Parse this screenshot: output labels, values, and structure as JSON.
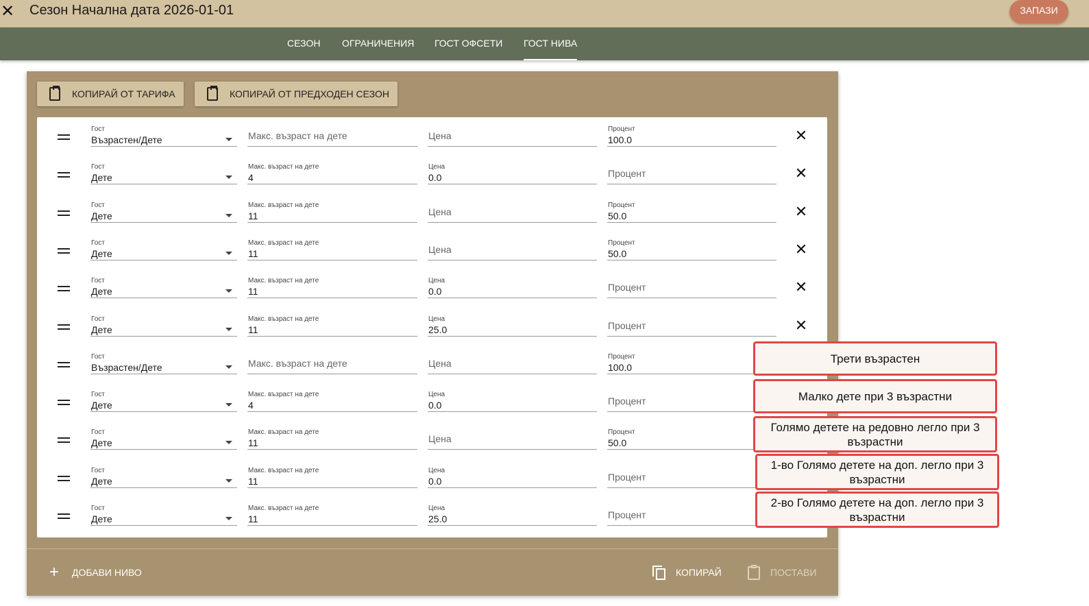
{
  "header": {
    "title": "Сезон Начална дата 2026-01-01",
    "close_icon": "close-icon",
    "save_label": "ЗАПАЗИ"
  },
  "tabs": [
    {
      "label": "СЕЗОН"
    },
    {
      "label": "ОГРАНИЧЕНИЯ"
    },
    {
      "label": "ГОСТ ОФСЕТИ"
    },
    {
      "label": "ГОСТ НИВА"
    }
  ],
  "active_tab": "ГОСТ НИВА",
  "actions": {
    "copy_from_tariff": "КОПИРАЙ ОТ ТАРИФА",
    "copy_from_previous": "КОПИРАЙ ОТ ПРЕДХОДЕН СЕЗОН"
  },
  "labels": {
    "guest": "Гост",
    "max_child_age": "Макс. възраст на дете",
    "price": "Цена",
    "percent": "Процент"
  },
  "rows": [
    {
      "guest": "Възрастен/Дете",
      "age": "",
      "price": "",
      "percent": "100.0",
      "deletable": true
    },
    {
      "guest": "Дете",
      "age": "4",
      "price": "0.0",
      "percent": "",
      "deletable": true
    },
    {
      "guest": "Дете",
      "age": "11",
      "price": "",
      "percent": "50.0",
      "deletable": true
    },
    {
      "guest": "Дете",
      "age": "11",
      "price": "",
      "percent": "50.0",
      "deletable": true
    },
    {
      "guest": "Дете",
      "age": "11",
      "price": "0.0",
      "percent": "",
      "deletable": true
    },
    {
      "guest": "Дете",
      "age": "11",
      "price": "25.0",
      "percent": "",
      "deletable": true
    },
    {
      "guest": "Възрастен/Дете",
      "age": "",
      "price": "",
      "percent": "100.0",
      "deletable": false
    },
    {
      "guest": "Дете",
      "age": "4",
      "price": "0.0",
      "percent": "",
      "deletable": false
    },
    {
      "guest": "Дете",
      "age": "11",
      "price": "",
      "percent": "50.0",
      "deletable": false
    },
    {
      "guest": "Дете",
      "age": "11",
      "price": "0.0",
      "percent": "",
      "deletable": false
    },
    {
      "guest": "Дете",
      "age": "11",
      "price": "25.0",
      "percent": "",
      "deletable": false
    }
  ],
  "footer": {
    "add_level": "ДОБАВИ НИВО",
    "copy": "КОПИРАЙ",
    "paste": "ПОСТАВИ"
  },
  "annotations": [
    "Трети възрастен",
    "Малко дете при 3 възрастни",
    "Голямо детете на редовно легло при 3 възрастни",
    "1-во Голямо детете на доп. легло при 3 възрастни",
    "2-во Голямо детете на доп. легло при 3 възрастни"
  ],
  "colors": {
    "topbar": "#d3c29f",
    "tabsbar": "#626e57",
    "panel": "#a89370",
    "save_button": "#c97a5e",
    "annotation_border": "#e24646"
  }
}
